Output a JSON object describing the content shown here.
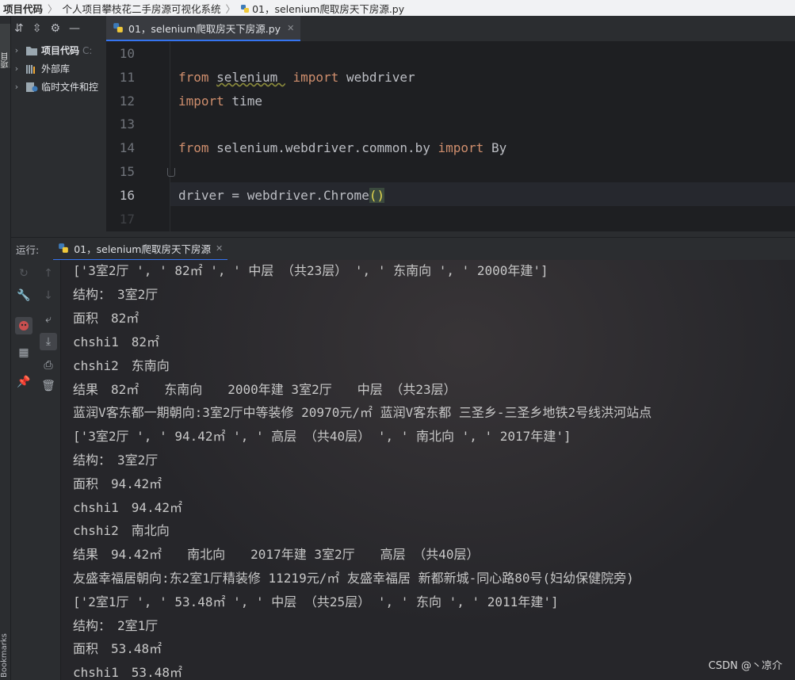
{
  "breadcrumb": {
    "items": [
      "项目代码",
      "个人项目攀枝花二手房源可视化系统",
      "01，selenium爬取房天下房源.py"
    ],
    "separator": "〉"
  },
  "left_strip": {
    "project_tab": "项目",
    "bookmarks_tab": "Bookmarks"
  },
  "project_tree": {
    "items": [
      {
        "label": "项目代码",
        "hint": "C:",
        "icon": "folder-icon",
        "bold": true
      },
      {
        "label": "外部库",
        "hint": "",
        "icon": "library-icon",
        "bold": false
      },
      {
        "label": "临时文件和控",
        "hint": "",
        "icon": "scratch-icon",
        "bold": false
      }
    ]
  },
  "editor": {
    "tab_label": "01，selenium爬取房天下房源.py",
    "line_numbers": [
      "10",
      "11",
      "12",
      "13",
      "14",
      "15",
      "16",
      "17"
    ],
    "current_line": "16"
  },
  "run": {
    "label": "运行:",
    "tab_label": "01，selenium爬取房天下房源"
  },
  "console_lines": [
    "['3室2厅 ', ' 82㎡ ', ' 中层 （共23层） ', ' 东南向 ', ' 2000年建']",
    "结构：　3室2厅",
    "面积　82㎡",
    "chshi1　82㎡",
    "chshi2　东南向",
    "结果　82㎡　　东南向　　2000年建 3室2厅　　中层 （共23层）",
    "蓝润V客东都一期朝向:3室2厅中等装修 20970元/㎡ 蓝润V客东都 三圣乡-三圣乡地铁2号线洪河站点",
    "['3室2厅 ', ' 94.42㎡ ', ' 高层 （共40层） ', ' 南北向 ', ' 2017年建']",
    "结构：　3室2厅",
    "面积　94.42㎡",
    "chshi1　94.42㎡",
    "chshi2　南北向",
    "结果　94.42㎡　　南北向　　2017年建 3室2厅　　高层 （共40层）",
    "友盛幸福居朝向:东2室1厅精装修 11219元/㎡ 友盛幸福居 新都新城-同心路80号(妇幼保健院旁)",
    "['2室1厅 ', ' 53.48㎡ ', ' 中层 （共25层） ', ' 东向 ', ' 2011年建']",
    "结构：　2室1厅",
    "面积　53.48㎡",
    "chshi1　53.48㎡"
  ],
  "watermark": "CSDN @丶凉介",
  "colors": {
    "keyword": "#cf8e6d",
    "accent": "#3574f0",
    "console_text": "#c8c8c8",
    "bracket_highlight": "#e6d94f"
  }
}
